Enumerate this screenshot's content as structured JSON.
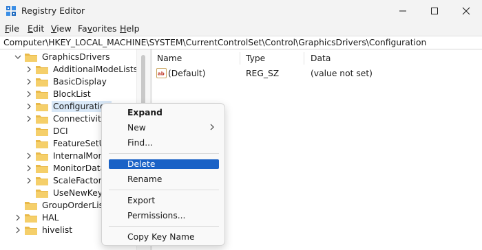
{
  "window": {
    "title": "Registry Editor"
  },
  "menubar": [
    {
      "label": "File",
      "key": "F",
      "rest": "ile"
    },
    {
      "label": "Edit",
      "key": "E",
      "rest": "dit"
    },
    {
      "label": "View",
      "key": "V",
      "rest": "iew"
    },
    {
      "label": "Favorites",
      "key": "F",
      "rest": "avorites",
      "prefix": ""
    },
    {
      "label": "Help",
      "key": "H",
      "rest": "elp"
    }
  ],
  "address": "Computer\\HKEY_LOCAL_MACHINE\\SYSTEM\\CurrentControlSet\\Control\\GraphicsDrivers\\Configuration",
  "tree": {
    "parent": "GraphicsDrivers",
    "children": [
      "AdditionalModeLists",
      "BasicDisplay",
      "BlockList",
      "Configuration",
      "Connectivity",
      "DCI",
      "FeatureSetUsa",
      "InternalMonEc",
      "MonitorDataSt",
      "ScaleFactors",
      "UseNewKey"
    ],
    "siblings": [
      "GroupOrderList",
      "HAL",
      "hivelist"
    ]
  },
  "values": {
    "headers": {
      "name": "Name",
      "type": "Type",
      "data": "Data"
    },
    "rows": [
      {
        "name": "(Default)",
        "type": "REG_SZ",
        "data": "(value not set)"
      }
    ]
  },
  "context_menu": {
    "items": [
      {
        "label": "Expand"
      },
      {
        "label": "New"
      },
      {
        "label": "Find..."
      },
      {
        "label": "Delete"
      },
      {
        "label": "Rename"
      },
      {
        "label": "Export"
      },
      {
        "label": "Permissions..."
      },
      {
        "label": "Copy Key Name"
      }
    ]
  },
  "icons": {
    "app": "registry-editor-icon",
    "folder": "folder-icon",
    "folder_color": "#e9b949",
    "accent": "#1a62c6"
  }
}
